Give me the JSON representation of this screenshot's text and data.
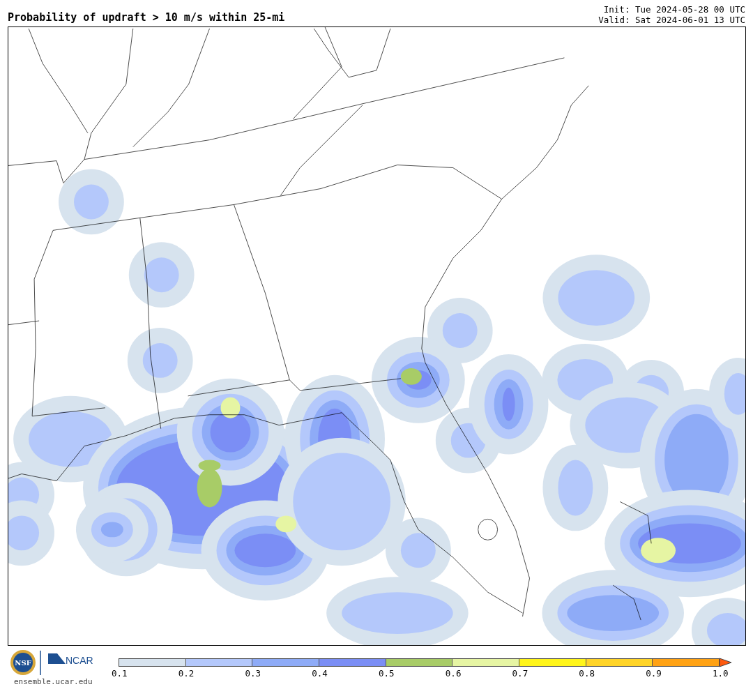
{
  "title": "Probability of updraft > 10 m/s within 25-mi",
  "init": "Init: Tue 2024-05-28 00 UTC",
  "valid": "Valid: Sat 2024-06-01 13 UTC",
  "logo": {
    "nsf": "NSF",
    "ncar": "NCAR",
    "url": "ensemble.ucar.edu"
  },
  "colorbar": {
    "segments": [
      {
        "color": "#d7e3ee"
      },
      {
        "color": "#b4c8fb"
      },
      {
        "color": "#8eabf7"
      },
      {
        "color": "#7b8ef5"
      },
      {
        "color": "#a8cc67"
      },
      {
        "color": "#e6f5a3"
      },
      {
        "color": "#fff51a"
      },
      {
        "color": "#ffd428"
      },
      {
        "color": "#ffa214"
      }
    ],
    "extend": {
      "color": "#ff5a0f"
    },
    "ticks": [
      "0.1",
      "0.2",
      "0.3",
      "0.4",
      "0.5",
      "0.6",
      "0.7",
      "0.8",
      "0.9",
      "1.0"
    ]
  }
}
